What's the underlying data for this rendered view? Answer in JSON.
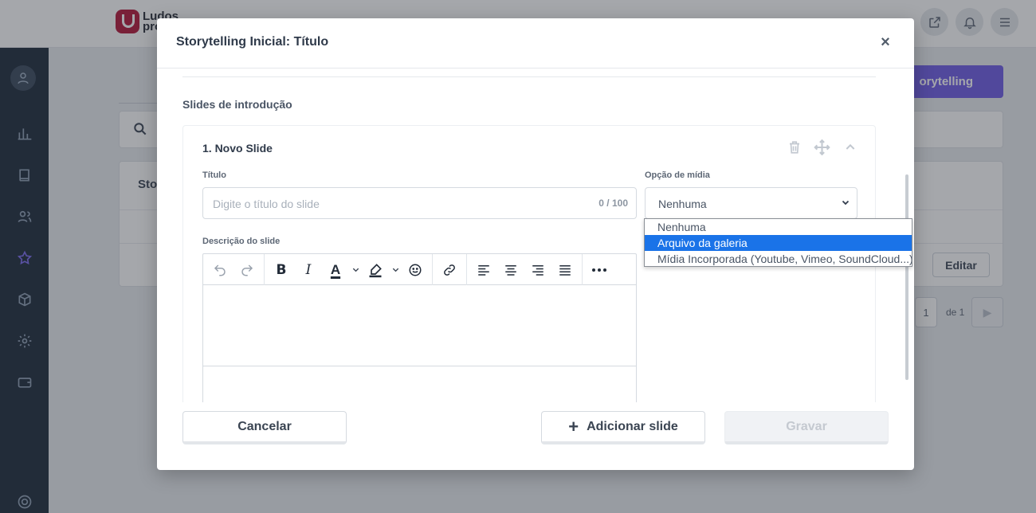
{
  "app": {
    "logo_text": "Ludos pro",
    "bg_primary_button": "orytelling",
    "bg_card_title": "Sto",
    "bg_edit_button": "Editar",
    "bg_pager_page": "1",
    "bg_pager_of": "de 1"
  },
  "modal": {
    "title": "Storytelling Inicial: Título",
    "close_label": "×",
    "section_title": "Slides de introdução",
    "slide": {
      "name": "1. Novo Slide",
      "title_label": "Título",
      "title_placeholder": "Digite o título do slide",
      "title_counter": "0 / 100",
      "media_label": "Opção de mídia",
      "media_value": "Nenhuma",
      "description_label": "Descrição do slide"
    },
    "media_options": [
      "Nenhuma",
      "Arquivo da galeria",
      "Mídia Incorporada (Youtube, Vimeo, SoundCloud...)"
    ],
    "media_highlighted": "Arquivo da galeria",
    "footer": {
      "cancel": "Cancelar",
      "add_slide": "Adicionar slide",
      "save": "Gravar"
    }
  },
  "colors": {
    "accent": "#6f5ce6",
    "sidebar": "#1e2b3c",
    "dropdown_highlight": "#1a73e8"
  },
  "icons": {
    "topbar": [
      "external-link-icon",
      "bell-icon",
      "menu-icon"
    ],
    "sidebar": [
      "chart-icon",
      "book-icon",
      "users-icon",
      "star-icon",
      "box-icon",
      "gear-icon",
      "wallet-icon",
      "lifebuoy-icon"
    ],
    "slide_actions": [
      "trash-icon",
      "move-icon",
      "chevron-up-icon"
    ],
    "toolbar": [
      "undo-icon",
      "redo-icon",
      "bold-icon",
      "italic-icon",
      "text-color-icon",
      "highlight-icon",
      "emoji-icon",
      "link-icon",
      "align-left-icon",
      "align-center-icon",
      "align-right-icon",
      "align-justify-icon",
      "more-icon"
    ]
  }
}
